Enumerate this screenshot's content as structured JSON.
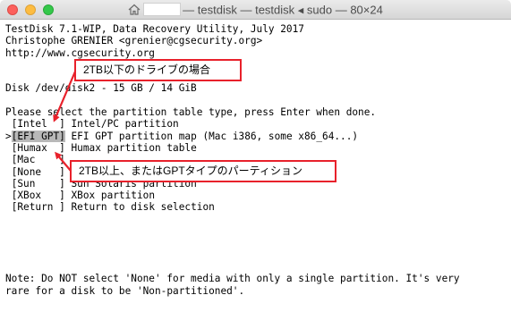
{
  "window": {
    "title": "— testdisk — testdisk ◂ sudo — 80×24"
  },
  "terminal": {
    "lines": [
      "TestDisk 7.1-WIP, Data Recovery Utility, July 2017",
      "Christophe GRENIER <grenier@cgsecurity.org>",
      "http://www.cgsecurity.org",
      "",
      "",
      "Disk /dev/disk2 - 15 GB / 14 GiB",
      "",
      "Please select the partition table type, press Enter when done."
    ],
    "options": [
      {
        "prefix": " ",
        "key": "[Intel  ]",
        "desc": "Intel/PC partition",
        "selected": false
      },
      {
        "prefix": ">",
        "key": "[EFI GPT]",
        "desc": "EFI GPT partition map (Mac i386, some x86_64...)",
        "selected": true
      },
      {
        "prefix": " ",
        "key": "[Humax  ]",
        "desc": "Humax partition table",
        "selected": false
      },
      {
        "prefix": " ",
        "key": "[Mac    ]",
        "desc": "",
        "selected": false
      },
      {
        "prefix": " ",
        "key": "[None   ]",
        "desc": "",
        "selected": false
      },
      {
        "prefix": " ",
        "key": "[Sun    ]",
        "desc": "Sun Solaris partition",
        "selected": false
      },
      {
        "prefix": " ",
        "key": "[XBox   ]",
        "desc": "XBox partition",
        "selected": false
      },
      {
        "prefix": " ",
        "key": "[Return ]",
        "desc": "Return to disk selection",
        "selected": false
      }
    ],
    "note_lines": [
      "Note: Do NOT select 'None' for media with only a single partition. It's very",
      "rare for a disk to be 'Non-partitioned'."
    ]
  },
  "annotations": {
    "callout_intel": "2TB以下のドライブの場合",
    "callout_gpt": "2TB以上、またはGPTタイプのパーティション",
    "color": "#e8212b"
  }
}
